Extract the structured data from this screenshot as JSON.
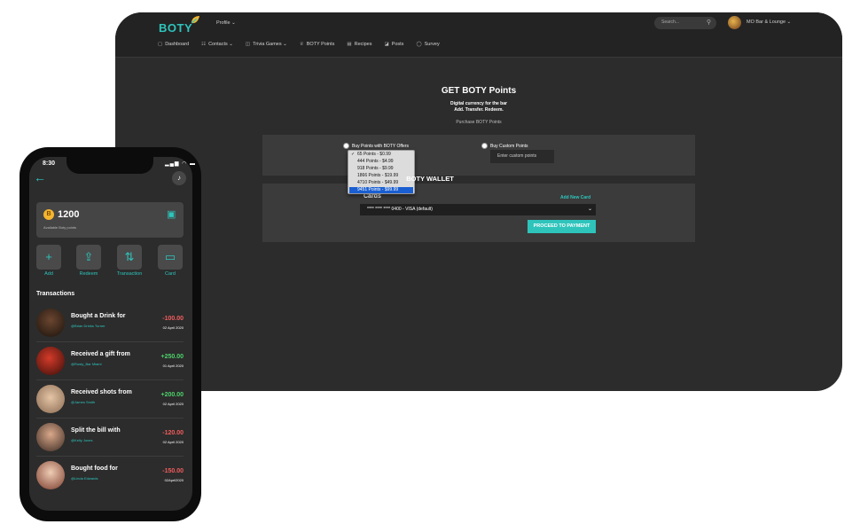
{
  "web": {
    "logo": "BOTY",
    "profile_menu": "Profile ⌄",
    "search_placeholder": "Search...",
    "venue_name": "MO Bar & Lounge ⌄",
    "menu": [
      {
        "label": "Dashboard",
        "icon": "chat-bubble-icon",
        "glyph": "▢"
      },
      {
        "label": "Contacts ⌄",
        "icon": "contacts-icon",
        "glyph": "☷"
      },
      {
        "label": "Trivia Games ⌄",
        "icon": "book-icon",
        "glyph": "◫"
      },
      {
        "label": "BOTY Points",
        "icon": "trophy-icon",
        "glyph": "♕"
      },
      {
        "label": "Recipes",
        "icon": "recipe-icon",
        "glyph": "▤"
      },
      {
        "label": "Posts",
        "icon": "posts-icon",
        "glyph": "◪"
      },
      {
        "label": "Survey",
        "icon": "survey-icon",
        "glyph": "◯"
      }
    ],
    "title": "GET BOTY Points",
    "subtitle_1": "Digital currency for the bar",
    "subtitle_2": "Add. Transfer. Redeem.",
    "section_label": "Purchase BOTY Points",
    "option_offers": "Buy Points with BOTY Offers",
    "option_custom": "Buy Custom Points",
    "custom_placeholder": "Enter custom points",
    "offers": [
      "65 Points - $0.99",
      "444 Points - $4.99",
      "918 Points - $9.99",
      "1866 Points - $19.99",
      "4710 Points - $49.99",
      "9451 Points - $99.99"
    ],
    "offers_selected_index": 5,
    "cards_label": "Cards",
    "add_new_card": "Add New Card",
    "card_value": "**** **** **** 0400 - VISA (default)",
    "pay_button": "PROCEED TO PAYMENT"
  },
  "phone": {
    "time": "8:30",
    "status": "▂▄▆ ◠ ▬",
    "title": "BOTY WALLET",
    "balance": "1200",
    "balance_sub": "Available Boty points",
    "actions": [
      {
        "label": "Add",
        "icon": "plus-icon",
        "glyph": "+"
      },
      {
        "label": "Redeem",
        "icon": "redeem-icon",
        "glyph": "⇪"
      },
      {
        "label": "Transaction",
        "icon": "transfer-icon",
        "glyph": "⇅"
      },
      {
        "label": "Card",
        "icon": "card-icon",
        "glyph": "▭"
      }
    ],
    "transactions_title": "Transactions",
    "transactions": [
      {
        "text": "Bought a Drink for",
        "user": "@Brian Drinks Turner",
        "amount": "-100.00",
        "date": "02 April 2020",
        "sign": "neg"
      },
      {
        "text": "Received a gift from",
        "user": "@Rusty_Bar Miami",
        "amount": "+250.00",
        "date": "01 April 2020",
        "sign": "pos"
      },
      {
        "text": "Received shots from",
        "user": "@James Smith",
        "amount": "+200.00",
        "date": "02 April 2020",
        "sign": "pos"
      },
      {
        "text": "Split the bill with",
        "user": "@Kelly Jones",
        "amount": "-120.00",
        "date": "02 April 2020",
        "sign": "neg"
      },
      {
        "text": "Bought food for",
        "user": "@Linda Edwards",
        "amount": "-150.00",
        "date": "02April2020",
        "sign": "neg"
      }
    ]
  },
  "colors": {
    "accent": "#2ec4bc",
    "negative": "#f25c5c",
    "positive": "#4dd26a"
  }
}
